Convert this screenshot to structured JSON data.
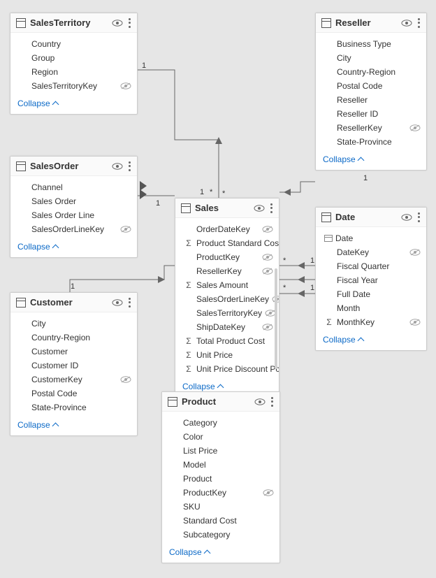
{
  "collapse_label": "Collapse",
  "tables": {
    "salesTerritory": {
      "title": "SalesTerritory",
      "fields": [
        {
          "name": "Country"
        },
        {
          "name": "Group"
        },
        {
          "name": "Region"
        },
        {
          "name": "SalesTerritoryKey",
          "hidden": true
        }
      ]
    },
    "reseller": {
      "title": "Reseller",
      "fields": [
        {
          "name": "Business Type"
        },
        {
          "name": "City"
        },
        {
          "name": "Country-Region"
        },
        {
          "name": "Postal Code"
        },
        {
          "name": "Reseller"
        },
        {
          "name": "Reseller ID"
        },
        {
          "name": "ResellerKey",
          "hidden": true
        },
        {
          "name": "State-Province"
        }
      ]
    },
    "salesOrder": {
      "title": "SalesOrder",
      "fields": [
        {
          "name": "Channel"
        },
        {
          "name": "Sales Order"
        },
        {
          "name": "Sales Order Line"
        },
        {
          "name": "SalesOrderLineKey",
          "hidden": true
        }
      ]
    },
    "sales": {
      "title": "Sales",
      "fields": [
        {
          "name": "OrderDateKey",
          "hidden": true
        },
        {
          "name": "Product Standard Cost",
          "pre": "Σ"
        },
        {
          "name": "ProductKey",
          "hidden": true
        },
        {
          "name": "ResellerKey",
          "hidden": true
        },
        {
          "name": "Sales Amount",
          "pre": "Σ"
        },
        {
          "name": "SalesOrderLineKey",
          "hidden": true
        },
        {
          "name": "SalesTerritoryKey",
          "hidden": true
        },
        {
          "name": "ShipDateKey",
          "hidden": true
        },
        {
          "name": "Total Product Cost",
          "pre": "Σ"
        },
        {
          "name": "Unit Price",
          "pre": "Σ"
        },
        {
          "name": "Unit Price Discount Pct",
          "pre": "Σ"
        }
      ]
    },
    "date": {
      "title": "Date",
      "fields": [
        {
          "name": "Date",
          "pre": "cal"
        },
        {
          "name": "DateKey",
          "hidden": true
        },
        {
          "name": "Fiscal Quarter"
        },
        {
          "name": "Fiscal Year"
        },
        {
          "name": "Full Date"
        },
        {
          "name": "Month"
        },
        {
          "name": "MonthKey",
          "pre": "Σ",
          "hidden": true
        }
      ]
    },
    "customer": {
      "title": "Customer",
      "fields": [
        {
          "name": "City"
        },
        {
          "name": "Country-Region"
        },
        {
          "name": "Customer"
        },
        {
          "name": "Customer ID"
        },
        {
          "name": "CustomerKey",
          "hidden": true
        },
        {
          "name": "Postal Code"
        },
        {
          "name": "State-Province"
        }
      ]
    },
    "product": {
      "title": "Product",
      "fields": [
        {
          "name": "Category"
        },
        {
          "name": "Color"
        },
        {
          "name": "List Price"
        },
        {
          "name": "Model"
        },
        {
          "name": "Product"
        },
        {
          "name": "ProductKey",
          "hidden": true
        },
        {
          "name": "SKU"
        },
        {
          "name": "Standard Cost"
        },
        {
          "name": "Subcategory"
        }
      ]
    }
  },
  "relationships": [
    {
      "from": "SalesTerritory",
      "to": "Sales",
      "fromCard": "1",
      "toCard": "*"
    },
    {
      "from": "Reseller",
      "to": "Sales",
      "fromCard": "1",
      "toCard": "*"
    },
    {
      "from": "SalesOrder",
      "to": "Sales",
      "fromCard": "1",
      "toCard": "*"
    },
    {
      "from": "Customer",
      "to": "Sales",
      "fromCard": "1",
      "toCard": "*"
    },
    {
      "from": "Date",
      "to": "Sales",
      "fromCard": "1",
      "toCard": "*"
    },
    {
      "from": "Product",
      "to": "Sales",
      "fromCard": "1",
      "toCard": "*"
    }
  ]
}
